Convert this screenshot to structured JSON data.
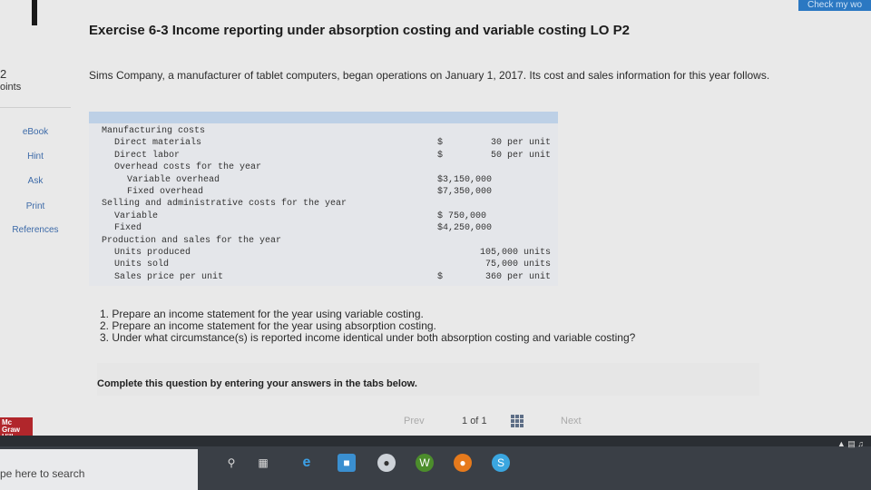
{
  "header": {
    "title": "Exercise 6-3 Income reporting under absorption costing and variable costing LO P2",
    "check_button": "Check my wo"
  },
  "sidebar": {
    "points_value": "2",
    "points_label": "oints",
    "links": [
      "eBook",
      "Hint",
      "Ask",
      "Print",
      "References"
    ],
    "logo": "Mc Graw Hill Education"
  },
  "intro": "Sims Company, a manufacturer of tablet computers, began operations on January 1, 2017. Its cost and sales information for this year follows.",
  "table": {
    "rows": [
      {
        "label": "Manufacturing costs",
        "indent": 0,
        "dollar": "",
        "value": ""
      },
      {
        "label": "Direct materials",
        "indent": 1,
        "dollar": "$",
        "value": "30 per unit"
      },
      {
        "label": "Direct labor",
        "indent": 1,
        "dollar": "$",
        "value": "50 per unit"
      },
      {
        "label": "Overhead costs for the year",
        "indent": 1,
        "dollar": "",
        "value": ""
      },
      {
        "label": "Variable overhead",
        "indent": 2,
        "dollar": "",
        "value2": "$3,150,000"
      },
      {
        "label": "Fixed overhead",
        "indent": 2,
        "dollar": "",
        "value2": "$7,350,000"
      },
      {
        "label": "Selling and administrative costs for the year",
        "indent": 0,
        "dollar": "",
        "value": ""
      },
      {
        "label": "Variable",
        "indent": 1,
        "dollar": "",
        "value2": "$  750,000"
      },
      {
        "label": "Fixed",
        "indent": 1,
        "dollar": "",
        "value2": "$4,250,000"
      },
      {
        "label": "Production and sales for the year",
        "indent": 0,
        "dollar": "",
        "value": ""
      },
      {
        "label": "Units produced",
        "indent": 1,
        "dollar": "",
        "value": "105,000 units"
      },
      {
        "label": "Units sold",
        "indent": 1,
        "dollar": "",
        "value": "75,000 units"
      },
      {
        "label": "Sales price per unit",
        "indent": 1,
        "dollar": "$",
        "value": "360 per unit"
      }
    ]
  },
  "questions": [
    "1. Prepare an income statement for the year using variable costing.",
    "2. Prepare an income statement for the year using absorption costing.",
    "3. Under what circumstance(s) is reported income identical under both absorption costing and variable costing?"
  ],
  "complete_text": "Complete this question by entering your answers in the tabs below.",
  "pager": {
    "prev": "Prev",
    "current": "1",
    "of": "of",
    "total": "1",
    "next": "Next"
  },
  "taskbar": {
    "search_text": "pe here to search"
  }
}
